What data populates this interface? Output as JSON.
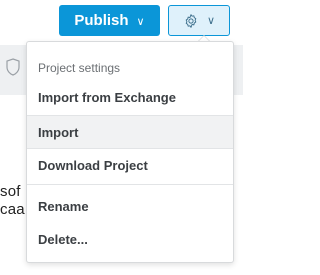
{
  "toolbar": {
    "publish_label": "Publish",
    "publish_chevron": "∨",
    "settings_icon": "gear-icon",
    "settings_chevron": "∨",
    "accent_color": "#0b96d8"
  },
  "background": {
    "line1": "sof",
    "line2": "caa"
  },
  "menu": {
    "header": "Project settings",
    "items": [
      {
        "label": "Import from Exchange"
      },
      {
        "label": "Import"
      },
      {
        "label": "Download Project"
      },
      {
        "label": "Rename"
      },
      {
        "label": "Delete..."
      }
    ]
  }
}
